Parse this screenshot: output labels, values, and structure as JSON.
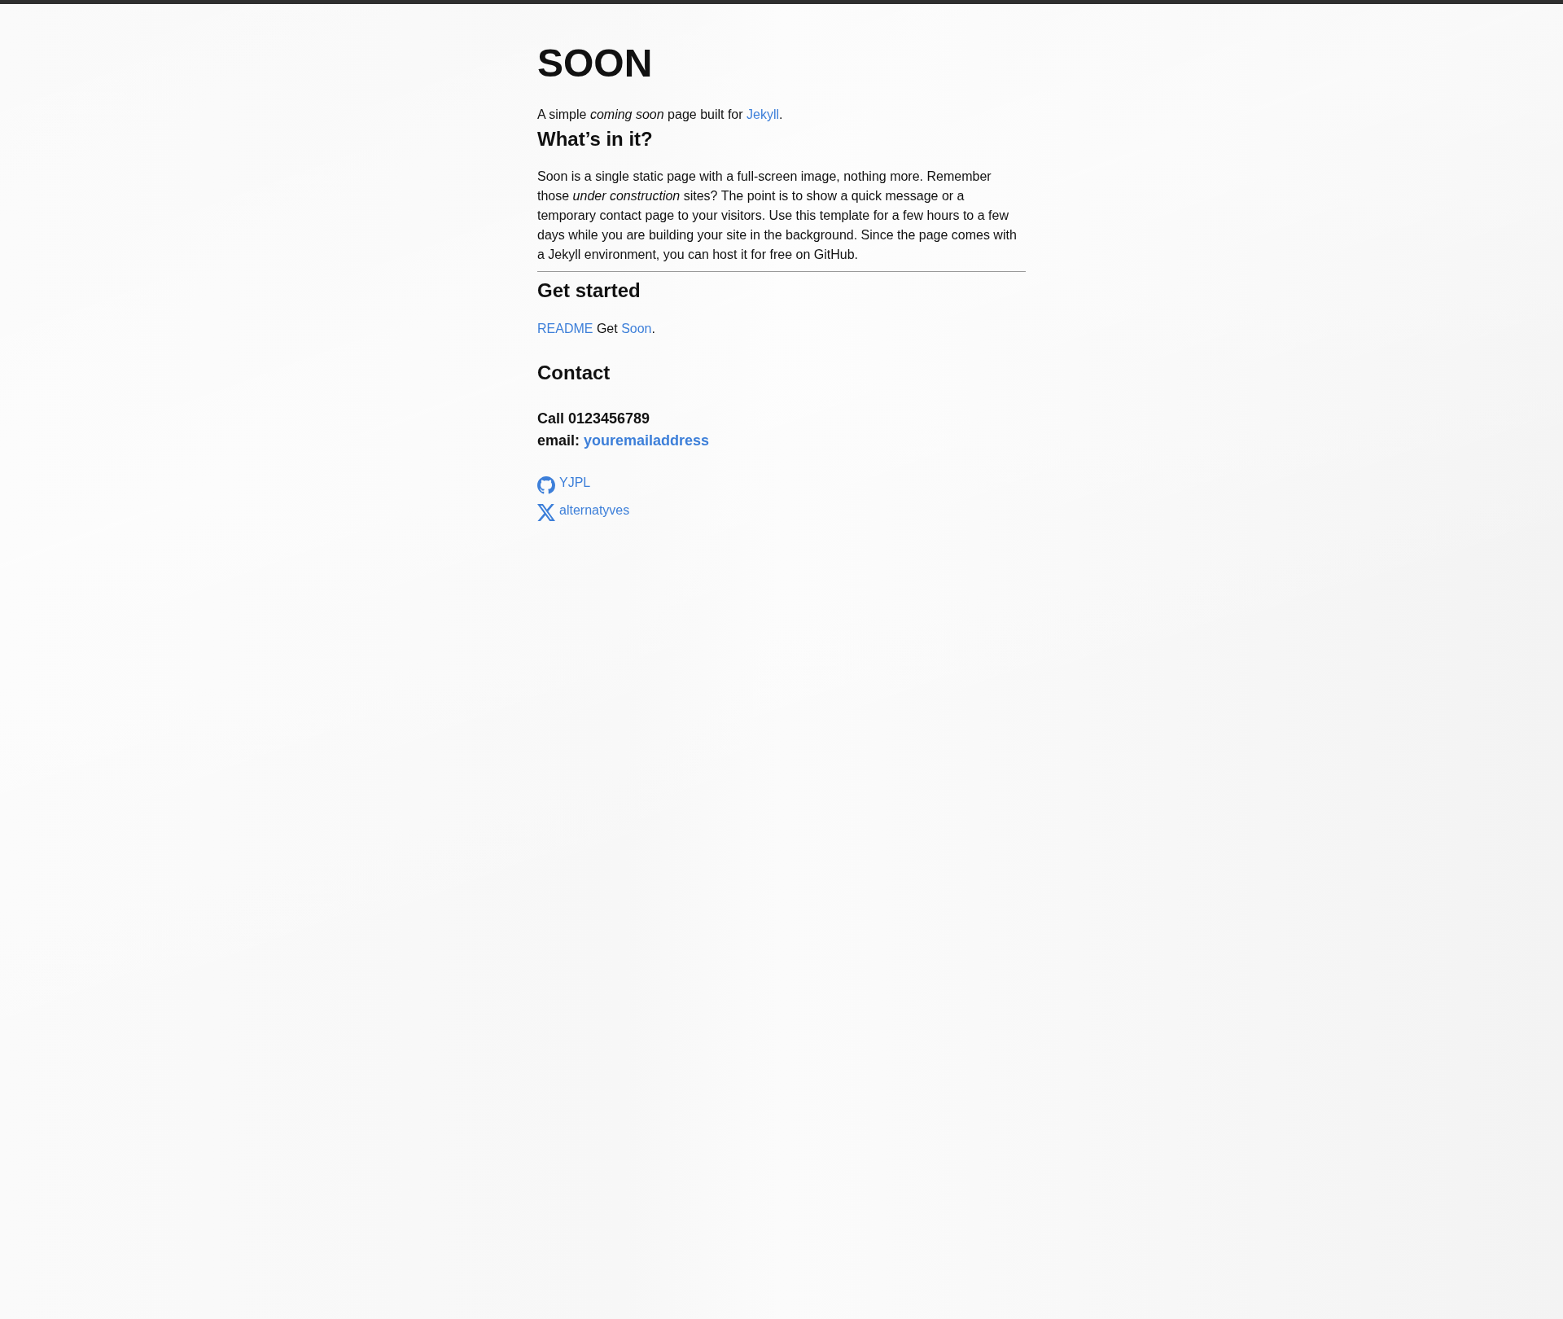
{
  "title": "SOON",
  "intro": [
    {
      "kind": "text",
      "text": "A simple *coming soon* page built for "
    },
    {
      "kind": "link",
      "text": "Jekyll"
    },
    {
      "kind": "text",
      "text": "."
    }
  ],
  "about": {
    "heading": "What’s in it?",
    "paragraph": "Soon is a single static page with a full-screen image, nothing more. Remember those *under construction* sites? The point is to show a quick message or a temporary contact page to your visitors. Use this template for a few hours to a few days while you are building your site in the background. Since the page comes with a Jekyll environment, you can host it for free on GitHub."
  },
  "get_started": {
    "heading": "Get started",
    "parts": [
      {
        "kind": "link",
        "text": "README"
      },
      {
        "kind": "text",
        "text": " Get "
      },
      {
        "kind": "link",
        "text": "Soon"
      },
      {
        "kind": "text",
        "text": "."
      }
    ]
  },
  "contact": {
    "heading": "Contact",
    "phone": "Call 0123456789",
    "email_label": "email: ",
    "email_link": "youremailaddress"
  },
  "social": [
    {
      "kind": "github",
      "label": "YJPL"
    },
    {
      "kind": "x",
      "label": "alternatyves"
    }
  ]
}
